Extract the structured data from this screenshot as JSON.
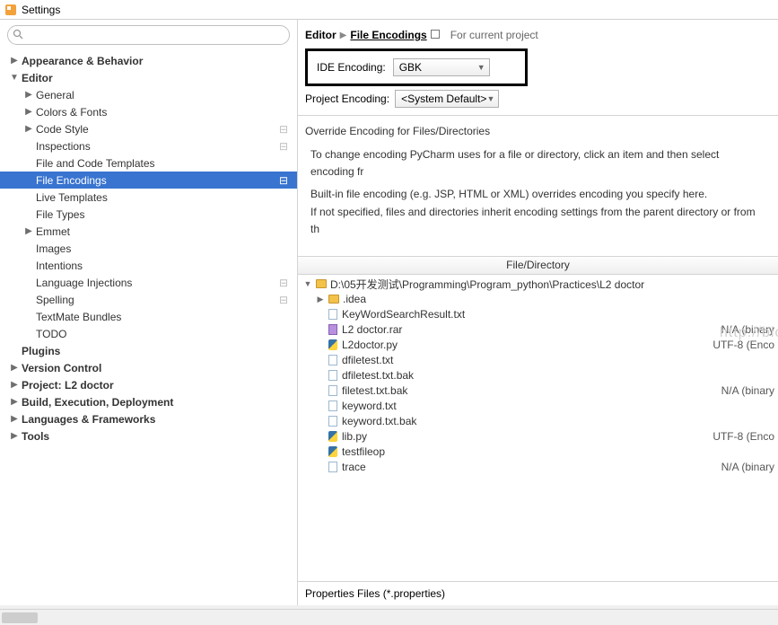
{
  "window": {
    "title": "Settings"
  },
  "search": {
    "placeholder": ""
  },
  "sidebar": {
    "items": [
      {
        "label": "Appearance & Behavior",
        "level": 1,
        "bold": true,
        "caret": "▶",
        "badge": ""
      },
      {
        "label": "Editor",
        "level": 1,
        "bold": true,
        "caret": "▼",
        "badge": ""
      },
      {
        "label": "General",
        "level": 2,
        "bold": false,
        "caret": "▶",
        "badge": ""
      },
      {
        "label": "Colors & Fonts",
        "level": 2,
        "bold": false,
        "caret": "▶",
        "badge": ""
      },
      {
        "label": "Code Style",
        "level": 2,
        "bold": false,
        "caret": "▶",
        "badge": "⊟"
      },
      {
        "label": "Inspections",
        "level": 2,
        "bold": false,
        "caret": "",
        "badge": "⊟"
      },
      {
        "label": "File and Code Templates",
        "level": 2,
        "bold": false,
        "caret": "",
        "badge": ""
      },
      {
        "label": "File Encodings",
        "level": 2,
        "bold": false,
        "caret": "",
        "badge": "⊟",
        "selected": true
      },
      {
        "label": "Live Templates",
        "level": 2,
        "bold": false,
        "caret": "",
        "badge": ""
      },
      {
        "label": "File Types",
        "level": 2,
        "bold": false,
        "caret": "",
        "badge": ""
      },
      {
        "label": "Emmet",
        "level": 2,
        "bold": false,
        "caret": "▶",
        "badge": ""
      },
      {
        "label": "Images",
        "level": 2,
        "bold": false,
        "caret": "",
        "badge": ""
      },
      {
        "label": "Intentions",
        "level": 2,
        "bold": false,
        "caret": "",
        "badge": ""
      },
      {
        "label": "Language Injections",
        "level": 2,
        "bold": false,
        "caret": "",
        "badge": "⊟"
      },
      {
        "label": "Spelling",
        "level": 2,
        "bold": false,
        "caret": "",
        "badge": "⊟"
      },
      {
        "label": "TextMate Bundles",
        "level": 2,
        "bold": false,
        "caret": "",
        "badge": ""
      },
      {
        "label": "TODO",
        "level": 2,
        "bold": false,
        "caret": "",
        "badge": ""
      },
      {
        "label": "Plugins",
        "level": 1,
        "bold": true,
        "caret": "",
        "badge": ""
      },
      {
        "label": "Version Control",
        "level": 1,
        "bold": true,
        "caret": "▶",
        "badge": ""
      },
      {
        "label": "Project: L2 doctor",
        "level": 1,
        "bold": true,
        "caret": "▶",
        "badge": ""
      },
      {
        "label": "Build, Execution, Deployment",
        "level": 1,
        "bold": true,
        "caret": "▶",
        "badge": ""
      },
      {
        "label": "Languages & Frameworks",
        "level": 1,
        "bold": true,
        "caret": "▶",
        "badge": ""
      },
      {
        "label": "Tools",
        "level": 1,
        "bold": true,
        "caret": "▶",
        "badge": ""
      }
    ]
  },
  "breadcrumb": {
    "root": "Editor",
    "leaf": "File Encodings",
    "project_note": "For current project"
  },
  "ide_encoding": {
    "label": "IDE Encoding:",
    "value": "GBK"
  },
  "project_encoding": {
    "label": "Project Encoding:",
    "value": "<System Default>"
  },
  "override_label": "Override Encoding for Files/Directories",
  "hints": {
    "p1": "To change encoding PyCharm uses for a file or directory, click an item and then select encoding fr",
    "p2": "Built-in file encoding (e.g. JSP, HTML or XML) overrides encoding you specify here.",
    "p3": "If not specified, files and directories inherit encoding settings from the parent directory or from th"
  },
  "file_tree": {
    "header": "File/Directory",
    "root": "D:\\05开发测试\\Programming\\Program_python\\Practices\\L2 doctor",
    "items": [
      {
        "name": ".idea",
        "type": "folder",
        "caret": "▶",
        "enc": ""
      },
      {
        "name": "KeyWordSearchResult.txt",
        "type": "file",
        "enc": ""
      },
      {
        "name": "L2 doctor.rar",
        "type": "rar",
        "enc": "N/A (binary"
      },
      {
        "name": "L2doctor.py",
        "type": "py",
        "enc": "UTF-8 (Enco"
      },
      {
        "name": "dfiletest.txt",
        "type": "file",
        "enc": ""
      },
      {
        "name": "dfiletest.txt.bak",
        "type": "file",
        "enc": ""
      },
      {
        "name": "filetest.txt.bak",
        "type": "file",
        "enc": "N/A (binary"
      },
      {
        "name": "keyword.txt",
        "type": "file",
        "enc": ""
      },
      {
        "name": "keyword.txt.bak",
        "type": "file",
        "enc": ""
      },
      {
        "name": "lib.py",
        "type": "py",
        "enc": "UTF-8 (Enco"
      },
      {
        "name": "testfileop",
        "type": "py",
        "enc": ""
      },
      {
        "name": "trace",
        "type": "file",
        "enc": "N/A (binary"
      }
    ]
  },
  "properties_label": "Properties Files (*.properties)",
  "watermark": "http://blog.csdn.net/"
}
